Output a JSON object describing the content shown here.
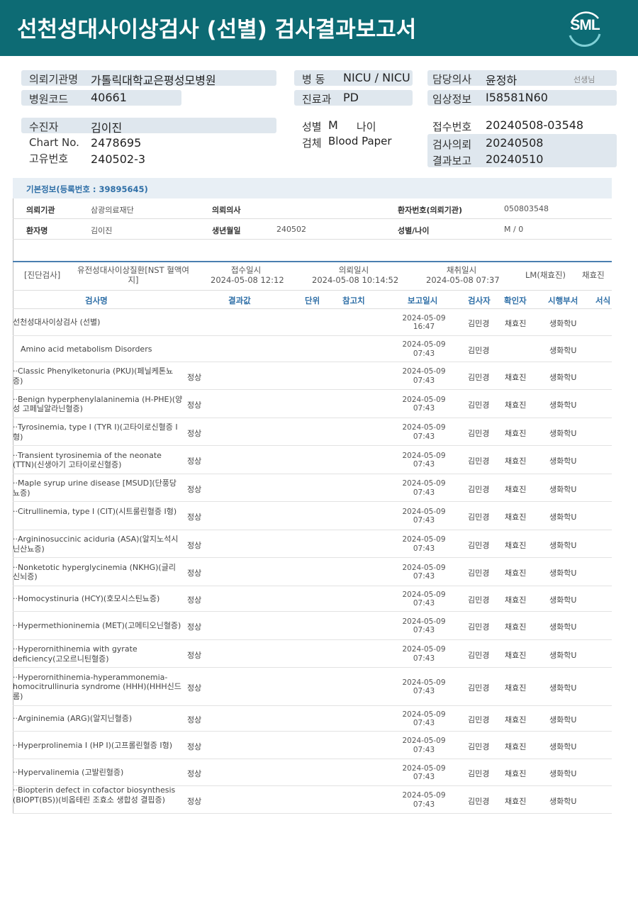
{
  "title": "선천성대사이상검사 (선별) 검사결과보고서",
  "logo": "SML",
  "info": {
    "hosp_label": "의뢰기관명",
    "hosp": "가톨릭대학교은평성모병원",
    "code_label": "병원코드",
    "code": "40661",
    "ward_label": "병  동",
    "ward": "NICU / NICU",
    "dept_label": "진료과",
    "dept": "PD",
    "doctor_label": "담당의사",
    "doctor": "윤정하",
    "doctor_suffix": "선생님",
    "clinic_label": "임상정보",
    "clinic": "I58581N60",
    "patient_label": "수진자",
    "patient": "김이진",
    "chart_label": "Chart No.",
    "chart": "2478695",
    "unique_label": "고유번호",
    "unique": "240502-3",
    "sex_label": "성별",
    "sex": "M",
    "age_label": "나이",
    "spec_label": "검체",
    "spec": "Blood Paper",
    "rec_label": "접수번호",
    "rec": "20240508-03548",
    "req_label": "검사의뢰",
    "req": "20240508",
    "rep_label": "결과보고",
    "rep": "20240510"
  },
  "basic": {
    "head": "기본정보(등록번호 : 39895645)",
    "inst_label": "의뢰기관",
    "inst": "삼광의료재단",
    "docr_label": "의뢰의사",
    "pno_label": "환자번호(의뢰기관)",
    "pno": "050803548",
    "name_label": "환자명",
    "name": "김이진",
    "birth_label": "생년월일",
    "birth": "240502",
    "sexage_label": "성별/나이",
    "sexage": "M / 0"
  },
  "summary": {
    "tag": "[진단검사]",
    "type": "유전성대사이상질환[NST 혈액여지]",
    "rec_label": "접수일시",
    "rec": "2024-05-08 12:12",
    "req_label": "의뢰일시",
    "req": "2024-05-08 10:14:52",
    "col_label": "채취일시",
    "col": "2024-05-08 07:37",
    "lm": "LM(채효진)",
    "tech": "채효진"
  },
  "headers": {
    "name": "검사명",
    "result": "결과값",
    "unit": "단위",
    "ref": "참고치",
    "date": "보고일시",
    "tester": "검사자",
    "checker": "확인자",
    "dept": "시행부서",
    "form": "서식"
  },
  "rows": [
    {
      "name": "선천성대사이상검사 (선별)",
      "result": "",
      "date": "2024-05-09",
      "time": "16:47",
      "p1": "김민경",
      "p2": "채효진",
      "dept": "생화학U"
    },
    {
      "name": "Amino acid metabolism Disorders",
      "result": "",
      "date": "2024-05-09",
      "time": "07:43",
      "p1": "김민경",
      "p2": "",
      "dept": "생화학U"
    },
    {
      "name": "··Classic Phenylketonuria (PKU)(페닐케톤뇨증)",
      "result": "정상",
      "date": "2024-05-09",
      "time": "07:43",
      "p1": "김민경",
      "p2": "채효진",
      "dept": "생화학U"
    },
    {
      "name": "··Benign hyperphenylalaninemia (H-PHE)(양성 고페닐알라닌혈증)",
      "result": "정상",
      "date": "2024-05-09",
      "time": "07:43",
      "p1": "김민경",
      "p2": "채효진",
      "dept": "생화학U"
    },
    {
      "name": "··Tyrosinemia, type I (TYR I)(고타이로신혈증 I형)",
      "result": "정상",
      "date": "2024-05-09",
      "time": "07:43",
      "p1": "김민경",
      "p2": "채효진",
      "dept": "생화학U"
    },
    {
      "name": "··Transient tyrosinemia of the neonate (TTN)(신생아기 고타이로신혈증)",
      "result": "정상",
      "date": "2024-05-09",
      "time": "07:43",
      "p1": "김민경",
      "p2": "채효진",
      "dept": "생화학U"
    },
    {
      "name": "··Maple syrup urine disease [MSUD](단풍당뇨증)",
      "result": "정상",
      "date": "2024-05-09",
      "time": "07:43",
      "p1": "김민경",
      "p2": "채효진",
      "dept": "생화학U"
    },
    {
      "name": "··Citrullinemia, type I (CIT)(시트룰린혈증 I형)",
      "result": "정상",
      "date": "2024-05-09",
      "time": "07:43",
      "p1": "김민경",
      "p2": "채효진",
      "dept": "생화학U"
    },
    {
      "name": "··Argininosuccinic aciduria (ASA)(알지노석시닌산뇨증)",
      "result": "정상",
      "date": "2024-05-09",
      "time": "07:43",
      "p1": "김민경",
      "p2": "채효진",
      "dept": "생화학U"
    },
    {
      "name": "··Nonketotic hyperglycinemia (NKHG)(글리신뇌증)",
      "result": "정상",
      "date": "2024-05-09",
      "time": "07:43",
      "p1": "김민경",
      "p2": "채효진",
      "dept": "생화학U"
    },
    {
      "name": "··Homocystinuria (HCY)(호모시스틴뇨증)",
      "result": "정상",
      "date": "2024-05-09",
      "time": "07:43",
      "p1": "김민경",
      "p2": "채효진",
      "dept": "생화학U"
    },
    {
      "name": "··Hypermethioninemia (MET)(고메티오닌혈증)",
      "result": "정상",
      "date": "2024-05-09",
      "time": "07:43",
      "p1": "김민경",
      "p2": "채효진",
      "dept": "생화학U"
    },
    {
      "name": "··Hyperornithinemia with gyrate deficiency(고오르니틴혈증)",
      "result": "정상",
      "date": "2024-05-09",
      "time": "07:43",
      "p1": "김민경",
      "p2": "채효진",
      "dept": "생화학U"
    },
    {
      "name": "··Hyperornithinemia-hyperammonemia-homocitrullinuria syndrome (HHH)(HHH신드롬)",
      "result": "정상",
      "date": "2024-05-09",
      "time": "07:43",
      "p1": "김민경",
      "p2": "채효진",
      "dept": "생화학U"
    },
    {
      "name": "··Argininemia (ARG)(알지닌혈증)",
      "result": "정상",
      "date": "2024-05-09",
      "time": "07:43",
      "p1": "김민경",
      "p2": "채효진",
      "dept": "생화학U"
    },
    {
      "name": "··Hyperprolinemia I (HP I)(고프롤린혈증 I형)",
      "result": "정상",
      "date": "2024-05-09",
      "time": "07:43",
      "p1": "김민경",
      "p2": "채효진",
      "dept": "생화학U"
    },
    {
      "name": "··Hypervalinemia (고발린혈증)",
      "result": "정상",
      "date": "2024-05-09",
      "time": "07:43",
      "p1": "김민경",
      "p2": "채효진",
      "dept": "생화학U"
    },
    {
      "name": "··Biopterin defect in cofactor biosynthesis (BIOPT(BS))(비옵테린 조효소 생합성 결핍증)",
      "result": "정상",
      "date": "2024-05-09",
      "time": "07:43",
      "p1": "김민경",
      "p2": "채효진",
      "dept": "생화학U"
    }
  ]
}
